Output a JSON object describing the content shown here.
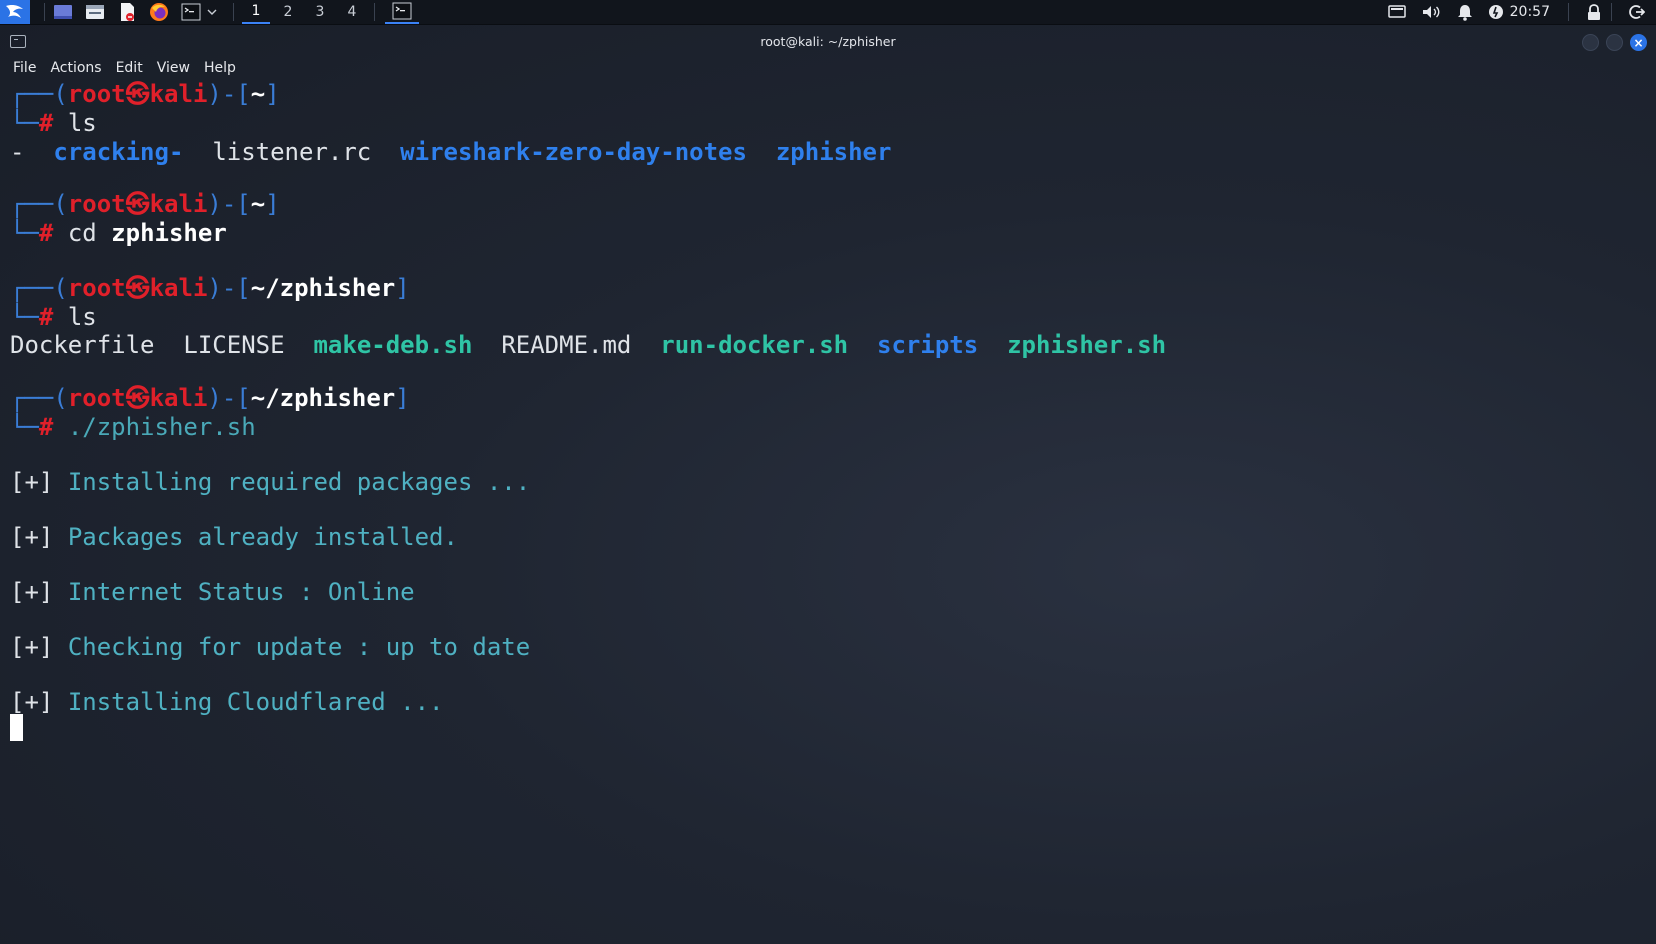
{
  "panel": {
    "workspaces": [
      "1",
      "2",
      "3",
      "4"
    ],
    "active_workspace": "1",
    "clock": "20:57",
    "accent": "#3b82f6"
  },
  "window": {
    "title": "root@kali: ~/zphisher"
  },
  "menu": [
    "File",
    "Actions",
    "Edit",
    "View",
    "Help"
  ],
  "terminal": {
    "prompt_user": "root",
    "prompt_host": "kali",
    "blocks": [
      {
        "dir": "~",
        "cmd": "ls",
        "cmd_arg": ""
      },
      {
        "dir": "~",
        "cmd": "cd",
        "cmd_arg": "zphisher"
      },
      {
        "dir": "~/zphisher",
        "cmd": "ls",
        "cmd_arg": ""
      },
      {
        "dir": "~/zphisher",
        "cmd": "./zphisher.sh",
        "cmd_arg": ""
      }
    ],
    "ls1": [
      {
        "name": "-",
        "kind": "plain"
      },
      {
        "name": "cracking-",
        "kind": "dir"
      },
      {
        "name": "listener.rc",
        "kind": "plain"
      },
      {
        "name": "wireshark-zero-day-notes",
        "kind": "dir"
      },
      {
        "name": "zphisher",
        "kind": "dir"
      }
    ],
    "ls2": [
      {
        "name": "Dockerfile",
        "kind": "plain"
      },
      {
        "name": "LICENSE",
        "kind": "plain"
      },
      {
        "name": "make-deb.sh",
        "kind": "exec"
      },
      {
        "name": "README.md",
        "kind": "plain"
      },
      {
        "name": "run-docker.sh",
        "kind": "exec"
      },
      {
        "name": "scripts",
        "kind": "dir"
      },
      {
        "name": "zphisher.sh",
        "kind": "exec"
      }
    ],
    "status_marker": "[+]",
    "status_lines": [
      "Installing required packages ...",
      "Packages already installed.",
      "Internet Status : Online",
      "Checking for update : up to date",
      "Installing Cloudflared ..."
    ],
    "colors": {
      "frame": "#3a7dd6",
      "user_host": "#e0202a",
      "dir_listing": "#2f80ed",
      "exec_listing": "#2fc4a5",
      "status_text": "#4fb1c2"
    }
  }
}
